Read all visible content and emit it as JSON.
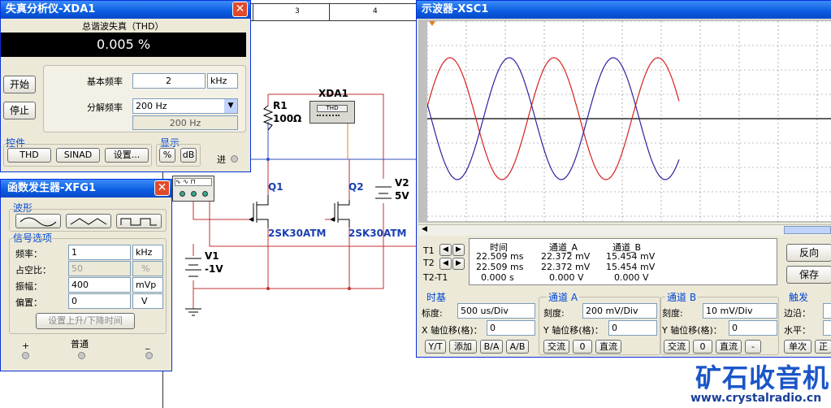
{
  "schematic": {
    "ruler": [
      "3",
      "4"
    ],
    "r1": {
      "ref": "R1",
      "value": "100Ω"
    },
    "xda_label": "XDA1",
    "xda_box_label": "THD",
    "q1": {
      "ref": "Q1",
      "model": "2SK30ATM"
    },
    "q2": {
      "ref": "Q2",
      "model": "2SK30ATM"
    },
    "v1": {
      "ref": "V1",
      "value": "-1V"
    },
    "v2": {
      "ref": "V2",
      "value": "5V"
    },
    "fg_terminals": [
      "+",
      "普通",
      "-"
    ]
  },
  "distortion_analyzer": {
    "title": "失真分析仪-XDA1",
    "heading": "总谐波失真（THD）",
    "display_value": "0.005 %",
    "start_button": "开始",
    "stop_button": "停止",
    "fundamental_label": "基本频率",
    "fundamental_value": "2",
    "fundamental_unit": "kHz",
    "resolution_label": "分解频率",
    "resolution_value": "200 Hz",
    "resolution_readout": "200 Hz",
    "controls_group": "控件",
    "thd_button": "THD",
    "sinad_button": "SINAD",
    "settings_button": "设置...",
    "display_group": "显示",
    "percent_button": "%",
    "db_button": "dB",
    "input_label": "进"
  },
  "function_generator": {
    "title": "函数发生器-XFG1",
    "waveform_group": "波形",
    "waveforms": [
      "sine-wave-icon",
      "triangle-wave-icon",
      "square-wave-icon"
    ],
    "signal_group": "信号选项",
    "frequency_label": "频率：",
    "frequency_value": "1",
    "frequency_unit": "kHz",
    "duty_label": "占空比：",
    "duty_value": "50",
    "duty_unit": "%",
    "amplitude_label": "振幅：",
    "amplitude_value": "400",
    "amplitude_unit": "mVp",
    "offset_label": "偏置：",
    "offset_value": "0",
    "offset_unit": "V",
    "rise_fall_button": "设置上升/下降时间",
    "terminals": [
      "+",
      "普通",
      "_"
    ]
  },
  "oscilloscope": {
    "title": "示波器-XSC1",
    "cursor_table": {
      "headers": [
        "时间",
        "通道_A",
        "通道_B"
      ],
      "rows": [
        {
          "label": "T1",
          "time": "22.509 ms",
          "a": "22.372 mV",
          "b": "15.454 mV"
        },
        {
          "label": "T2",
          "time": "22.509 ms",
          "a": "22.372 mV",
          "b": "15.454 mV"
        },
        {
          "label": "T2-T1",
          "time": "0.000 s",
          "a": "0.000 V",
          "b": "0.000 V"
        }
      ]
    },
    "reverse_button": "反向",
    "save_button": "保存",
    "timebase": {
      "group": "时基",
      "scale_label": "标度:",
      "scale_value": "500 us/Div",
      "xpos_label": "X 轴位移(格)：",
      "xpos_value": "0",
      "buttons": [
        "Y/T",
        "添加",
        "B/A",
        "A/B"
      ]
    },
    "channel_a": {
      "group": "通道 A",
      "scale_label": "刻度:",
      "scale_value": "200 mV/Div",
      "ypos_label": "Y 轴位移(格)：",
      "ypos_value": "0",
      "buttons": [
        "交流",
        "0",
        "直流"
      ]
    },
    "channel_b": {
      "group": "通道 B",
      "scale_label": "刻度:",
      "scale_value": "10 mV/Div",
      "ypos_label": "Y 轴位移(格)：",
      "ypos_value": "0",
      "buttons": [
        "交流",
        "0",
        "直流",
        "-"
      ]
    },
    "trigger": {
      "group": "触发",
      "edge_label": "边沿：",
      "level_label": "水平：",
      "buttons": [
        "单次",
        "正"
      ]
    },
    "colors": {
      "screen": "#ffffff",
      "channel_a": "#d42020",
      "channel_b": "#3020a0",
      "grid": "#808080"
    }
  },
  "watermark": {
    "brand": "矿石收音机",
    "url": "www.crystalradio.cn"
  }
}
